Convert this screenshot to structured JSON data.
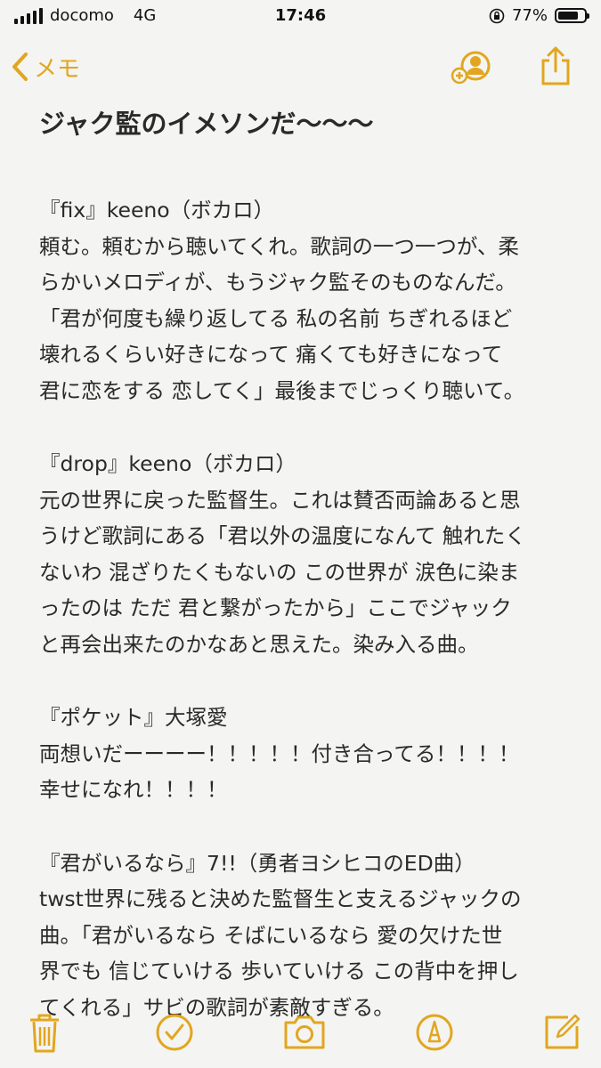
{
  "status_bar": {
    "carrier": "docomo",
    "network": "4G",
    "time": "17:46",
    "battery_percent": "77%",
    "battery_level": 0.77
  },
  "nav": {
    "back_label": "メモ",
    "icons": [
      "add-person-icon",
      "share-icon"
    ]
  },
  "note": {
    "title": "ジャク監のイメソンだ〜〜〜",
    "sections": [
      {
        "song": "『fix』keeno（ボカロ）",
        "lines": [
          "頼む。頼むから聴いてくれ。歌詞の一つ一つが、柔",
          "らかいメロディが、もうジャク監そのものなんだ。",
          "「君が何度も繰り返してる 私の名前 ちぎれるほど",
          "壊れるくらい好きになって 痛くても好きになって",
          "君に恋をする 恋してく」最後までじっくり聴いて。"
        ]
      },
      {
        "song": "『drop』keeno（ボカロ）",
        "lines": [
          "元の世界に戻った監督生。これは賛否両論あると思",
          "うけど歌詞にある「君以外の温度になんて 触れたく",
          "ないわ 混ざりたくもないの この世界が 涙色に染ま",
          "ったのは ただ 君と繋がったから」ここでジャック",
          "と再会出来たのかなあと思えた。染み入る曲。"
        ]
      },
      {
        "song": "『ポケット』大塚愛",
        "lines": [
          "両想いだーーーー！！！！！付き合ってる！！！！",
          "幸せになれ！！！！"
        ]
      },
      {
        "song": "『君がいるなら』7!!（勇者ヨシヒコのED曲）",
        "lines": [
          "twst世界に残ると決めた監督生と支えるジャックの",
          "曲。「君がいるなら そばにいるなら 愛の欠けた世",
          "界でも 信じていける 歩いていける この背中を押し",
          "てくれる」サビの歌詞が素敵すぎる。"
        ]
      }
    ]
  },
  "toolbar": {
    "icons": [
      "trash-icon",
      "checklist-icon",
      "camera-icon",
      "markup-icon",
      "compose-icon"
    ]
  },
  "colors": {
    "accent": "#e2a61e",
    "background": "#f4f4f2",
    "text": "#2a2a2a"
  }
}
